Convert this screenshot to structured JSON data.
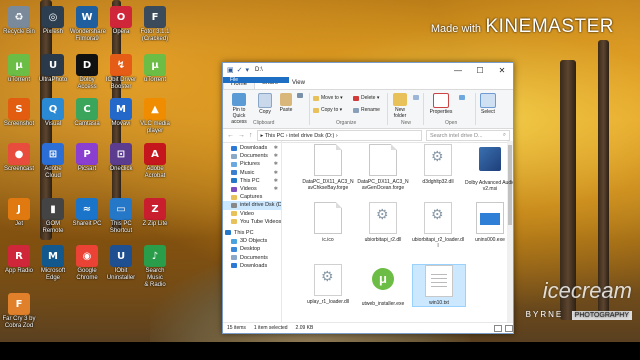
{
  "watermark": {
    "made_with": "Made with",
    "brand": "KINEMASTER"
  },
  "bottom_watermark": {
    "icecream": "icecream",
    "byrne": "BYRNE",
    "photography": "PHOTOGRAPHY"
  },
  "desktop_icons": [
    {
      "label": "Recycle Bin",
      "color": "#7a8a9a",
      "glyph": "♻"
    },
    {
      "label": "Pixresh",
      "color": "#2c3e50",
      "glyph": "◎"
    },
    {
      "label": "Wondershare\nFilmora9",
      "color": "#1f5fa0",
      "glyph": "W"
    },
    {
      "label": "Opera",
      "color": "#d0263a",
      "glyph": "O"
    },
    {
      "label": "Fotor 3.1.1\n(Cracked)",
      "color": "#3b4b5c",
      "glyph": "F"
    },
    {
      "label": "uTorrent",
      "color": "#6cbd45",
      "glyph": "μ"
    },
    {
      "label": "UltraPhoto",
      "color": "#2b3a4a",
      "glyph": "U"
    },
    {
      "label": "Dolby Access",
      "color": "#111111",
      "glyph": "D"
    },
    {
      "label": "IObit Driver\nBooster",
      "color": "#e45c15",
      "glyph": "↯"
    },
    {
      "label": "uTorrent",
      "color": "#6cbd45",
      "glyph": "μ"
    },
    {
      "label": "Screenshot",
      "color": "#e35d10",
      "glyph": "S"
    },
    {
      "label": "Visual",
      "color": "#2a8bd4",
      "glyph": "Q"
    },
    {
      "label": "Camtasia",
      "color": "#3ba55c",
      "glyph": "C"
    },
    {
      "label": "Movavi",
      "color": "#2468c9",
      "glyph": "M"
    },
    {
      "label": "VLC media\nplayer",
      "color": "#f08c00",
      "glyph": "▲"
    },
    {
      "label": "Screencast",
      "color": "#e84c3d",
      "glyph": "●"
    },
    {
      "label": "Adobe Cloud",
      "color": "#2b6ed6",
      "glyph": "⊞"
    },
    {
      "label": "Picsart",
      "color": "#8a3fd0",
      "glyph": "P"
    },
    {
      "label": "Oneclick",
      "color": "#5b3c8f",
      "glyph": "⊡"
    },
    {
      "label": "Adobe\nAcrobat",
      "color": "#c4161c",
      "glyph": "A"
    },
    {
      "label": "Jet",
      "color": "#e07a10",
      "glyph": "J"
    },
    {
      "label": "GOM\nRemote",
      "color": "#444444",
      "glyph": "▮"
    },
    {
      "label": "Shareit PC",
      "color": "#1a74c9",
      "glyph": "≈"
    },
    {
      "label": "This PC\nShortcut",
      "color": "#2577c8",
      "glyph": "▭"
    },
    {
      "label": "Z Zip Lite",
      "color": "#c81e2e",
      "glyph": "Z"
    },
    {
      "label": "App Radio",
      "color": "#d0263a",
      "glyph": "R"
    },
    {
      "label": "Microsoft\nEdge",
      "color": "#12588d",
      "glyph": "M"
    },
    {
      "label": "Google\nChrome",
      "color": "#ea4335",
      "glyph": "◉"
    },
    {
      "label": "IObit\nUninstaller",
      "color": "#1d4f91",
      "glyph": "U"
    },
    {
      "label": "Search Music\n& Radio",
      "color": "#2a9d4b",
      "glyph": "♪"
    },
    {
      "label": "Far Cry 3 by\nCobra Zod",
      "color": "#e0802a",
      "glyph": "F"
    }
  ],
  "window": {
    "title": "D:\\",
    "quick_access": [
      "▣",
      "✓",
      "▾"
    ],
    "controls": {
      "min": "—",
      "max": "☐",
      "close": "✕"
    },
    "tabs": {
      "file": "File",
      "home": "Home",
      "share": "Share",
      "view": "View"
    },
    "ribbon": {
      "pin": "Pin to Quick\naccess",
      "copy": "Copy",
      "paste": "Paste",
      "clipboard": "Clipboard",
      "move_to": "Move to ▾",
      "copy_to": "Copy to ▾",
      "delete": "Delete ▾",
      "rename": "Rename",
      "organize": "Organize",
      "new_folder": "New\nfolder",
      "new": "New",
      "properties": "Properties",
      "open": "Open",
      "select": "Select"
    },
    "address": {
      "back": "←",
      "forward": "→",
      "up": "↑",
      "path": "▸  This PC  ›  intel drive  Dsk (D:)  ›",
      "search_placeholder": "Search intel drive D...",
      "search_icon": "⌕"
    },
    "nav_items": [
      {
        "label": "Downloads",
        "color": "#2d7ad6",
        "pin": "✱",
        "top": false
      },
      {
        "label": "Documents",
        "color": "#8aa8c8",
        "pin": "✱",
        "top": false
      },
      {
        "label": "Pictures",
        "color": "#6aa9e0",
        "pin": "✱",
        "top": false
      },
      {
        "label": "Music",
        "color": "#3b7fd1",
        "pin": "✱",
        "top": false
      },
      {
        "label": "This PC",
        "color": "#2577c8",
        "pin": "✱",
        "top": false
      },
      {
        "label": "Videos",
        "color": "#7b4fc0",
        "pin": "✱",
        "top": false
      },
      {
        "label": "Captures",
        "color": "#e8c15a",
        "pin": "",
        "top": false
      },
      {
        "label": "intel drive Dsk (D:)",
        "color": "#888888",
        "pin": "",
        "top": false
      },
      {
        "label": "Video",
        "color": "#e8c15a",
        "pin": "",
        "top": false
      },
      {
        "label": "You Tube Videos",
        "color": "#e8c15a",
        "pin": "",
        "top": false
      },
      {
        "label": "This PC",
        "color": "#2577c8",
        "pin": "",
        "top": true
      },
      {
        "label": "3D Objects",
        "color": "#4aa3df",
        "pin": "",
        "top": false
      },
      {
        "label": "Desktop",
        "color": "#3b8ad9",
        "pin": "",
        "top": false
      },
      {
        "label": "Documents",
        "color": "#8aa8c8",
        "pin": "",
        "top": false
      },
      {
        "label": "Downloads",
        "color": "#2d7ad6",
        "pin": "",
        "top": false
      }
    ],
    "files": [
      {
        "label": "DataPC_DX11_AC3_NavChkseBay.forge",
        "type": "doc"
      },
      {
        "label": "DataPC_DX11_AC3_NavGenOcean.forge",
        "type": "doc"
      },
      {
        "label": "d3dghltp32.dll",
        "type": "gear"
      },
      {
        "label": "Dolby Advanced Audio v2.msi",
        "type": "setup"
      },
      {
        "label": "ic.ico",
        "type": "doc"
      },
      {
        "label": "ubiorbitapi_r2.dll",
        "type": "gear"
      },
      {
        "label": "ubiorbitapi_r2_loader.dll",
        "type": "gear"
      },
      {
        "label": "unins000.exe",
        "type": "exe"
      },
      {
        "label": "uplay_r1_loader.dll",
        "type": "gear"
      },
      {
        "label": "utweb_installer.exe",
        "type": "utor"
      },
      {
        "label": "win10.txt",
        "type": "txt",
        "selected": true
      }
    ],
    "status": {
      "count": "15 items",
      "selected": "1 item selected",
      "size": "2.09 KB"
    }
  }
}
